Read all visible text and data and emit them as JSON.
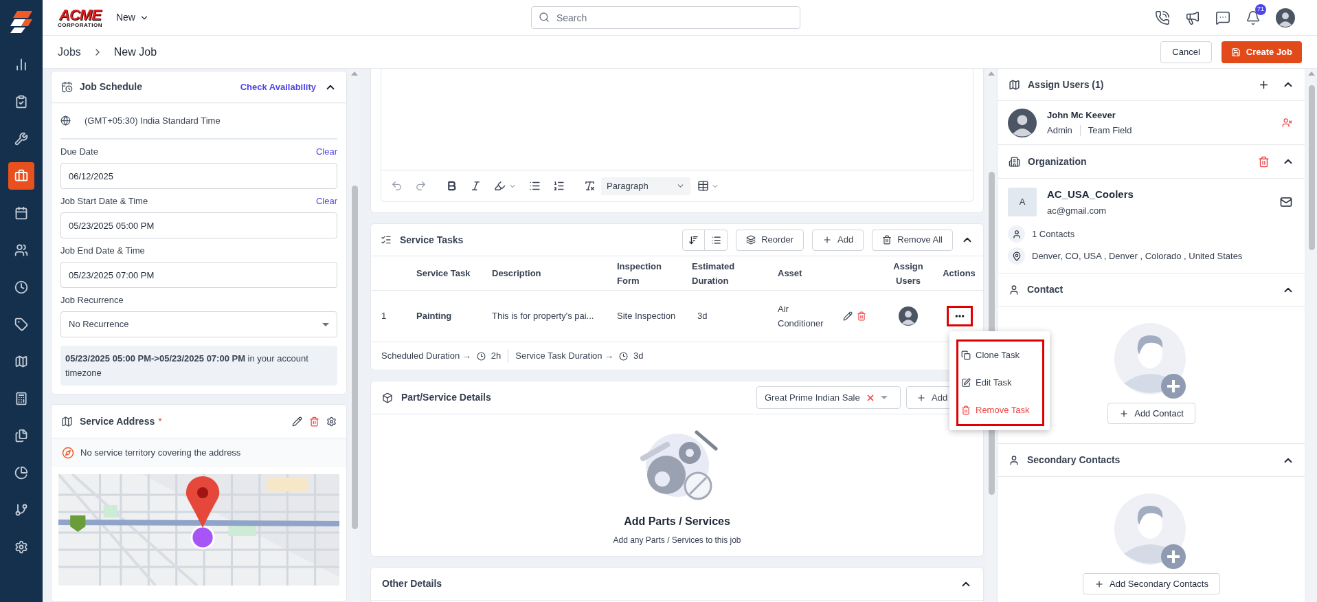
{
  "nav": [
    {
      "selected": false
    },
    {
      "selected": false
    },
    {
      "selected": false
    },
    {
      "selected": true
    },
    {
      "selected": false
    },
    {
      "selected": false
    },
    {
      "selected": false
    },
    {
      "selected": false
    },
    {
      "selected": false
    },
    {
      "selected": false
    },
    {
      "selected": false
    },
    {
      "selected": false
    },
    {
      "selected": false
    },
    {
      "selected": false
    }
  ],
  "top_bar": {
    "brand": "ACME",
    "brand_sub": "CORPORATION",
    "menu": "New",
    "search_placeholder": "Search",
    "notification_count": "71"
  },
  "breadcrumb": [
    "Jobs",
    "New Job"
  ],
  "page_actions": {
    "cancel": "Cancel",
    "create": "Create Job"
  },
  "job_schedule": {
    "title": "Job Schedule",
    "link": "Check Availability",
    "expanded": true,
    "timezone": "(GMT+05:30) India Standard Time",
    "fields": [
      {
        "kind": "input",
        "label": "Due Date",
        "value": "06/12/2025",
        "action": "Clear"
      },
      {
        "kind": "input",
        "label": "Job Start Date & Time",
        "value": "05/23/2025 05:00 PM",
        "action": "Clear"
      },
      {
        "kind": "input",
        "label": "Job End Date & Time",
        "value": "05/23/2025 07:00 PM"
      },
      {
        "kind": "select",
        "label": "Job Recurrence",
        "value": "No Recurrence"
      }
    ],
    "summary": "**05/23/2025 05:00 PM->05/23/2025 07:00 PM** in your account timezone"
  },
  "service_address": {
    "title": "Service Address",
    "required_mark": "*",
    "notice": "No service territory covering the address"
  },
  "editor": {
    "block_format": "Paragraph"
  },
  "service_tasks": {
    "title": "Service Tasks",
    "expanded": true,
    "toolbar": [
      "Reorder",
      "Add",
      "Remove All"
    ],
    "columns": [
      "Service Task",
      "Description",
      "Inspection Form",
      "Estimated Duration",
      "Asset",
      "Assign Users",
      "Actions"
    ],
    "rows": [
      {
        "index": "1",
        "service_task": "Painting",
        "description": "This is for property's pai...",
        "inspection_form": "Site Inspection",
        "estimated_duration": "3d",
        "asset": "Air Conditioner",
        "actions_highlighted": true
      }
    ],
    "footer": {
      "scheduled_label": "Scheduled Duration →",
      "scheduled": "2h",
      "task_label": "Service Task Duration →",
      "task": "3d"
    },
    "menu": {
      "highlighted": true,
      "items": [
        {
          "label": "Clone Task",
          "kind": "clone"
        },
        {
          "label": "Edit Task",
          "kind": "edit"
        },
        {
          "label": "Remove Task",
          "kind": "danger"
        }
      ]
    }
  },
  "parts": {
    "title": "Part/Service Details",
    "price_list": "Great Prime Indian Sale",
    "add": "Add",
    "empty_title": "Add Parts / Services",
    "empty_text": "Add any Parts / Services to this job"
  },
  "other_details": {
    "title": "Other Details",
    "expanded": true
  },
  "assign_users": {
    "title": "Assign Users (1)",
    "expanded": true,
    "users": [
      {
        "name": "John Mc Keever",
        "role": "Admin",
        "team": "Team Field"
      }
    ]
  },
  "organization": {
    "title": "Organization",
    "expanded": true,
    "initial": "A",
    "name": "AC_USA_Coolers",
    "email": "ac@gmail.com",
    "contacts": "1 Contacts",
    "address": "Denver, CO, USA , Denver , Colorado , United States"
  },
  "contact": {
    "title": "Contact",
    "expanded": true,
    "button": "Add Contact"
  },
  "secondary_contacts": {
    "title": "Secondary Contacts",
    "expanded": true,
    "button": "Add Secondary Contacts"
  }
}
